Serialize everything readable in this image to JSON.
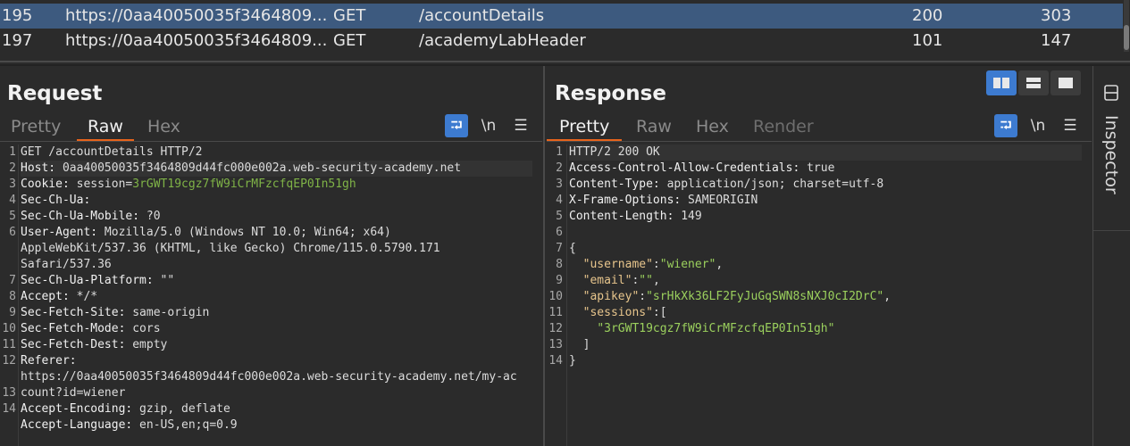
{
  "history": {
    "rows": [
      {
        "id": "195",
        "host": "https://0aa40050035f3464809...",
        "method": "GET",
        "path": "/accountDetails",
        "status": "200",
        "length": "303"
      },
      {
        "id": "197",
        "host": "https://0aa40050035f3464809...",
        "method": "GET",
        "path": "/academyLabHeader",
        "status": "101",
        "length": "147"
      }
    ]
  },
  "request": {
    "title": "Request",
    "tabs": [
      "Pretty",
      "Raw",
      "Hex"
    ],
    "active_tab": "Raw",
    "newline_label": "\\n",
    "gutter": [
      "1",
      "2",
      "3",
      "4",
      "5",
      "6",
      "",
      "",
      "7",
      "8",
      "9",
      "10",
      "11",
      "12",
      "",
      "13",
      "14"
    ],
    "lines": [
      {
        "k": "",
        "v": "GET /accountDetails HTTP/2"
      },
      {
        "k": "Host:",
        "v": " 0aa40050035f3464809d44fc000e002a.web-security-academy.net"
      },
      {
        "k": "Cookie:",
        "v": " session=",
        "g": "3rGWT19cgz7fW9iCrMFzcfqEP0In51gh"
      },
      {
        "k": "Sec-Ch-Ua:",
        "v": ""
      },
      {
        "k": "Sec-Ch-Ua-Mobile:",
        "v": " ?0"
      },
      {
        "k": "User-Agent:",
        "v": " Mozilla/5.0 (Windows NT 10.0; Win64; x64)"
      },
      {
        "k": "",
        "v": "AppleWebKit/537.36 (KHTML, like Gecko) Chrome/115.0.5790.171"
      },
      {
        "k": "",
        "v": "Safari/537.36"
      },
      {
        "k": "Sec-Ch-Ua-Platform:",
        "v": " \"\""
      },
      {
        "k": "Accept:",
        "v": " */*"
      },
      {
        "k": "Sec-Fetch-Site:",
        "v": " same-origin"
      },
      {
        "k": "Sec-Fetch-Mode:",
        "v": " cors"
      },
      {
        "k": "Sec-Fetch-Dest:",
        "v": " empty"
      },
      {
        "k": "Referer:",
        "v": ""
      },
      {
        "k": "",
        "v": "https://0aa40050035f3464809d44fc000e002a.web-security-academy.net/my-ac"
      },
      {
        "k": "",
        "v": "count?id=wiener"
      },
      {
        "k": "Accept-Encoding:",
        "v": " gzip, deflate"
      },
      {
        "k": "Accept-Language:",
        "v": " en-US,en;q=0.9"
      }
    ]
  },
  "response": {
    "title": "Response",
    "tabs": [
      "Pretty",
      "Raw",
      "Hex",
      "Render"
    ],
    "active_tab": "Pretty",
    "newline_label": "\\n",
    "gutter": [
      "1",
      "2",
      "3",
      "4",
      "5",
      "6",
      "7",
      "8",
      "9",
      "10",
      "11",
      "12",
      "13",
      "14"
    ],
    "lines": [
      {
        "k": "",
        "v": "HTTP/2 200 OK"
      },
      {
        "k": "Access-Control-Allow-Credentials:",
        "v": " true"
      },
      {
        "k": "Content-Type:",
        "v": " application/json; charset=utf-8"
      },
      {
        "k": "X-Frame-Options:",
        "v": " SAMEORIGIN"
      },
      {
        "k": "Content-Length:",
        "v": " 149"
      },
      {
        "k": "",
        "v": ""
      },
      {
        "k": "",
        "v": "{"
      },
      {
        "jk": "  \"username\"",
        "v": ":",
        "jv": "\"wiener\"",
        "t": ","
      },
      {
        "jk": "  \"email\"",
        "v": ":",
        "jv": "\"\"",
        "t": ","
      },
      {
        "jk": "  \"apikey\"",
        "v": ":",
        "jv": "\"srHkXk36LF2FyJuGqSWN8sNXJ0cI2DrC\"",
        "t": ","
      },
      {
        "jk": "  \"sessions\"",
        "v": ":[",
        "jv": "",
        "t": ""
      },
      {
        "k": "",
        "v": "    ",
        "jv": "\"3rGWT19cgz7fW9iCrMFzcfqEP0In51gh\""
      },
      {
        "k": "",
        "v": "  ]"
      },
      {
        "k": "",
        "v": "}"
      }
    ]
  },
  "inspector": {
    "label": "Inspector",
    "icon": "inspector-icon"
  },
  "colors": {
    "accent": "#3d7bd0",
    "tab_underline": "#e8641c",
    "selected_row": "#3d5a7f"
  }
}
